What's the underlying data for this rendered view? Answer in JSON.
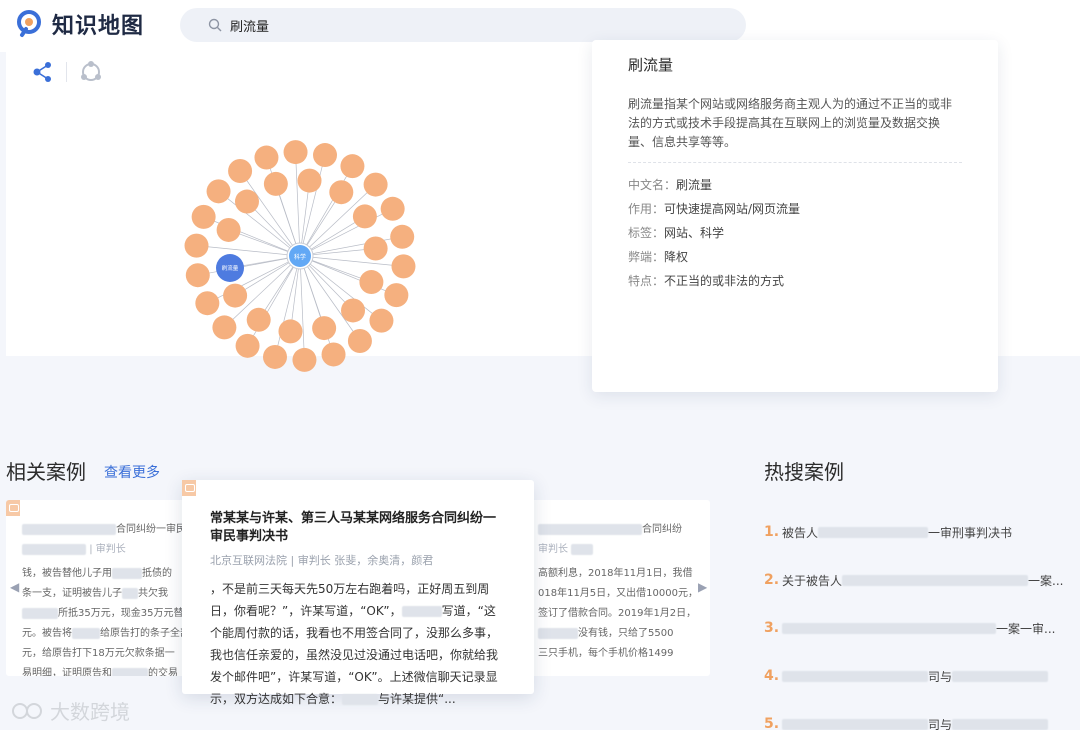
{
  "header": {
    "logo_text": "知识地图",
    "search": {
      "value": "刷流量",
      "placeholder": ""
    }
  },
  "graph": {
    "tools": [
      "share-graph-icon",
      "circle-layout-icon"
    ],
    "nodes": {
      "main": "刷流量",
      "hub": "科学"
    }
  },
  "info": {
    "title": "刷流量",
    "description": "刷流量指某个网站或网络服务商主观人为的通过不正当的或非法的方式或技术手段提高其在互联网上的浏览量及数据交换量、信息共享等等。",
    "fields": [
      {
        "key": "中文名：",
        "value": "刷流量"
      },
      {
        "key": "作用：",
        "value": "可快速提高网站/网页流量"
      },
      {
        "key": "标签：",
        "value": "网站、科学"
      },
      {
        "key": "弊端：",
        "value": "降权"
      },
      {
        "key": "特点：",
        "value": "不正当的或非法的方式"
      }
    ]
  },
  "related": {
    "title": "相关案例",
    "see_more": "查看更多",
    "main_case": {
      "title": "常某某与许某、第三人马某某网络服务合同纠纷一审民事判决书",
      "court": "北京互联网法院 | 审判长 张斐，余奥清，颜君",
      "body_a": "，不是前三天每天先50万左右跑着吗，正好周五到周日，你看呢？”，许某写道，“OK”，",
      "body_b": "写道，“这个能周付款的话，我看也不用签合同了，没那么多事，我也信任亲爱的，虽然没见过没通过电话吧，你就给我发个邮件吧”，许某写道，“OK”。上述微信聊天记录显示，双方达成如下合意：",
      "body_c": "与许某提供“..."
    },
    "left_case": {
      "title_tail": "合同纠纷一审民",
      "court_tail": "| 审判长",
      "lines": [
        "钱，被告替他儿子用",
        "抵债的",
        "条一支，证明被告儿子",
        "共欠我",
        "所抵35万元，现金35万元替",
        "元。被告将",
        "给原告打的条子全部",
        "元，给原告打下18万元欠款条据一",
        "易明细，证明原告和",
        "的交易"
      ]
    },
    "right_case": {
      "title_tail": "合同纠纷",
      "court_tail": "审判长",
      "lines": [
        "高额利息，2018年11月1日，我借",
        "018年11月5日，又出借10000元，",
        "签订了借款合同。2019年1月2日，",
        "没有钱，只给了5500",
        "三只手机，每个手机价格1499"
      ]
    }
  },
  "hot": {
    "title": "热搜案例",
    "items": [
      {
        "num": "1.",
        "prefix": "被告人",
        "suffix": "一审刑事判决书"
      },
      {
        "num": "2.",
        "prefix": "关于被告人",
        "suffix": "一案..."
      },
      {
        "num": "3.",
        "prefix": "",
        "suffix": "一案一审..."
      },
      {
        "num": "4.",
        "prefix": "",
        "suffix": "司与"
      },
      {
        "num": "5.",
        "prefix": "",
        "suffix": "司与"
      }
    ]
  },
  "watermark": "大数跨境",
  "colors": {
    "accent": "#3a6fd8",
    "node": "#f5b07f",
    "main_node": "#4e7be0",
    "hub_node": "#62a8f5",
    "hot_num": "#f0a160"
  }
}
